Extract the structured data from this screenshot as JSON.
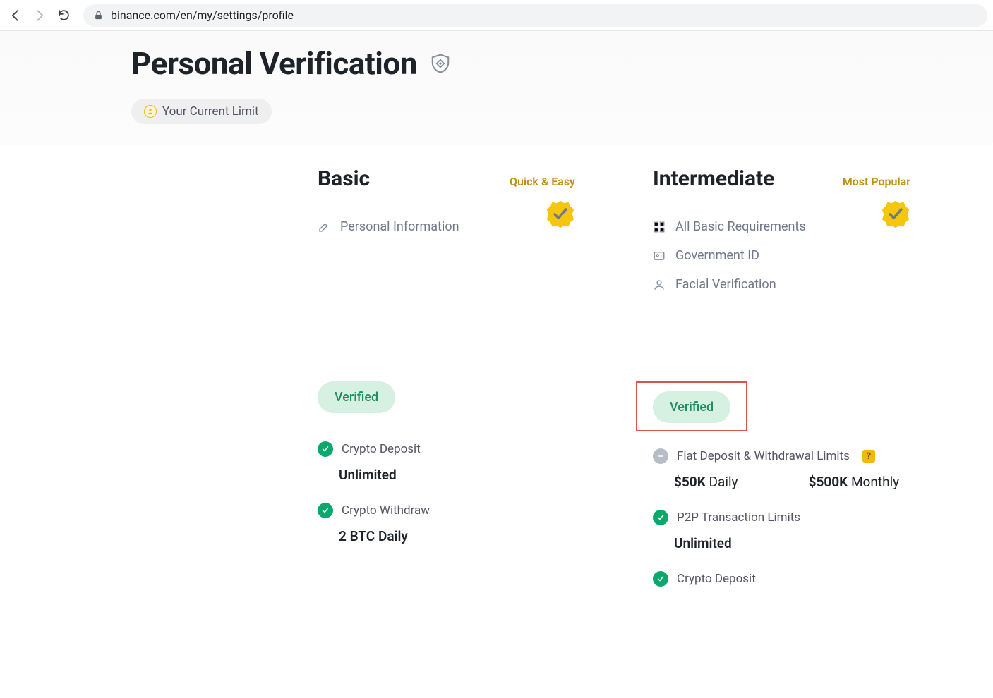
{
  "browser": {
    "url": "binance.com/en/my/settings/profile"
  },
  "page": {
    "title": "Personal Verification",
    "limit_badge": "Your Current Limit"
  },
  "tiers": {
    "basic": {
      "name": "Basic",
      "tag": "Quick & Easy",
      "requirements": {
        "personal_info": "Personal Information"
      },
      "status": "Verified",
      "features": {
        "deposit_label": "Crypto Deposit",
        "deposit_value": "Unlimited",
        "withdraw_label": "Crypto Withdraw",
        "withdraw_value": "2 BTC Daily"
      }
    },
    "intermediate": {
      "name": "Intermediate",
      "tag": "Most Popular",
      "requirements": {
        "all_basic": "All Basic Requirements",
        "gov_id": "Government ID",
        "facial": "Facial Verification"
      },
      "status": "Verified",
      "features": {
        "fiat_label": "Fiat Deposit & Withdrawal Limits",
        "fiat_daily_amount": "$50K",
        "fiat_daily_period": "Daily",
        "fiat_monthly_amount": "$500K",
        "fiat_monthly_period": "Monthly",
        "p2p_label": "P2P Transaction Limits",
        "p2p_value": "Unlimited",
        "deposit_label": "Crypto Deposit"
      }
    }
  }
}
